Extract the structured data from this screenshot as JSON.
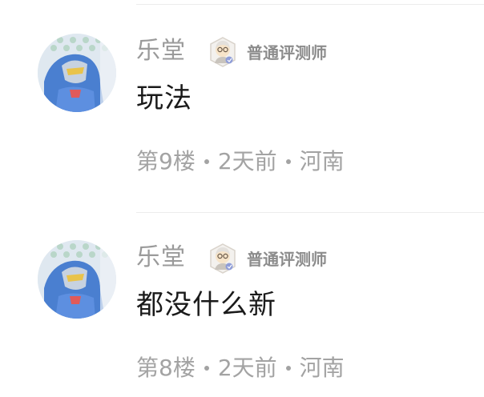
{
  "comments": [
    {
      "username": "乐堂",
      "badge": {
        "label": "普通评测师",
        "icon": "reviewer-badge-icon"
      },
      "text": "玩法",
      "floor": "第9楼",
      "time": "2天前",
      "location": "河南"
    },
    {
      "username": "乐堂",
      "badge": {
        "label": "普通评测师",
        "icon": "reviewer-badge-icon"
      },
      "text": "都没什么新",
      "floor": "第8楼",
      "time": "2天前",
      "location": "河南"
    }
  ]
}
